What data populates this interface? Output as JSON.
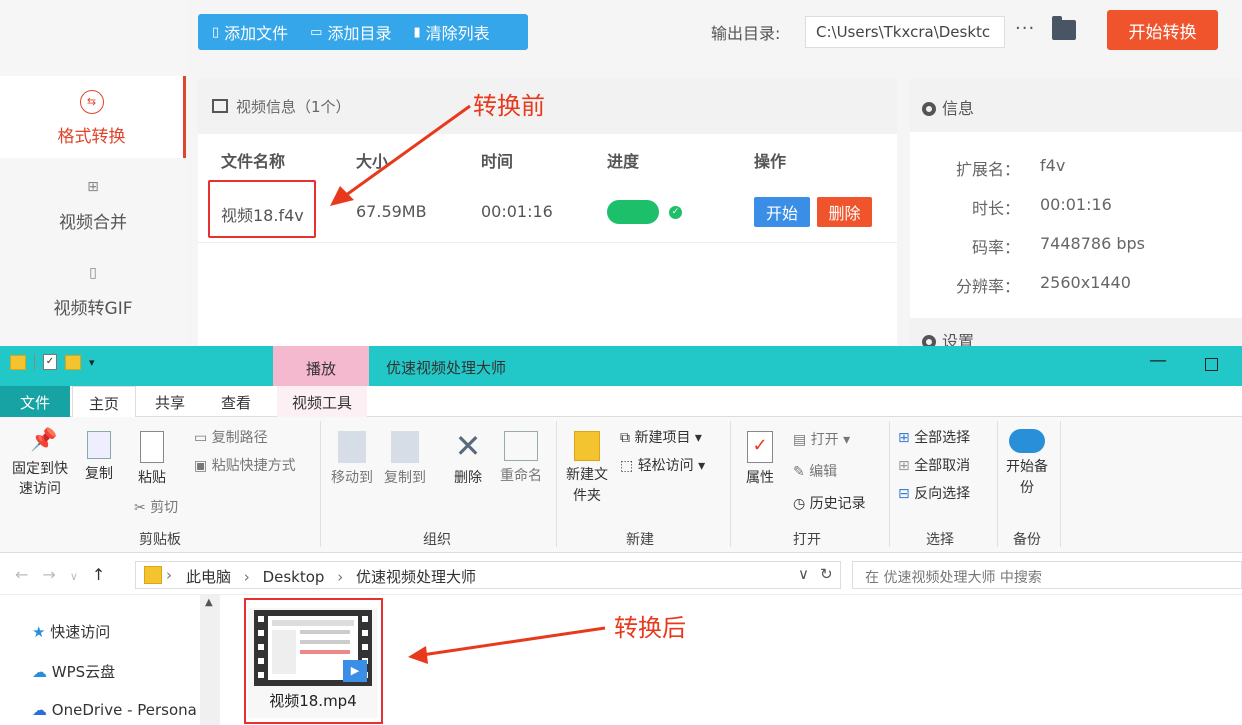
{
  "converter": {
    "toolbar": {
      "add_file": "添加文件",
      "add_dir": "添加目录",
      "clear_list": "清除列表"
    },
    "output_label": "输出目录:",
    "output_path": "C:\\Users\\Tkxcra\\Desktc",
    "more": "···",
    "start_all": "开始转换",
    "nav": [
      {
        "label": "格式转换",
        "icon": "format-convert-icon",
        "active": true
      },
      {
        "label": "视频合并",
        "icon": "video-merge-icon",
        "active": false
      },
      {
        "label": "视频转GIF",
        "icon": "gif-icon",
        "active": false
      }
    ],
    "panel_title": "视频信息（1个）",
    "columns": [
      "文件名称",
      "大小",
      "时间",
      "进度",
      "操作"
    ],
    "row": {
      "name": "视频18.f4v",
      "size": "67.59MB",
      "duration": "00:01:16",
      "progress": 1.0,
      "start": "开始",
      "delete": "删除"
    },
    "info_title": "信息",
    "info": [
      {
        "key": "扩展名：",
        "value": "f4v"
      },
      {
        "key": "时长：",
        "value": "00:01:16"
      },
      {
        "key": "码率：",
        "value": "7448786 bps"
      },
      {
        "key": "分辨率：",
        "value": "2560x1440"
      }
    ],
    "settings_title": "设置"
  },
  "annotations": {
    "before": "转换前",
    "after": "转换后"
  },
  "explorer": {
    "context_tab": "播放",
    "title": "优速视频处理大师",
    "tabs": [
      "文件",
      "主页",
      "共享",
      "查看",
      "视频工具"
    ],
    "ribbon": {
      "pin": "固定到快速访问",
      "copy": "复制",
      "paste": "粘贴",
      "copy_path": "复制路径",
      "paste_shortcut": "粘贴快捷方式",
      "cut": "剪切",
      "move_to": "移动到",
      "copy_to": "复制到",
      "delete": "删除",
      "rename": "重命名",
      "new_folder": "新建文件夹",
      "new_item": "新建项目",
      "easy_access": "轻松访问",
      "properties": "属性",
      "open": "打开",
      "edit": "编辑",
      "history": "历史记录",
      "select_all": "全部选择",
      "select_none": "全部取消",
      "invert": "反向选择",
      "backup": "开始备份"
    },
    "groups": [
      "剪贴板",
      "组织",
      "新建",
      "打开",
      "选择",
      "备份"
    ],
    "breadcrumb": [
      "此电脑",
      "Desktop",
      "优速视频处理大师"
    ],
    "search_placeholder": "在 优速视频处理大师 中搜索",
    "nav_items": [
      "快速访问",
      "WPS云盘",
      "OneDrive - Persona"
    ],
    "file_name": "视频18.mp4"
  }
}
